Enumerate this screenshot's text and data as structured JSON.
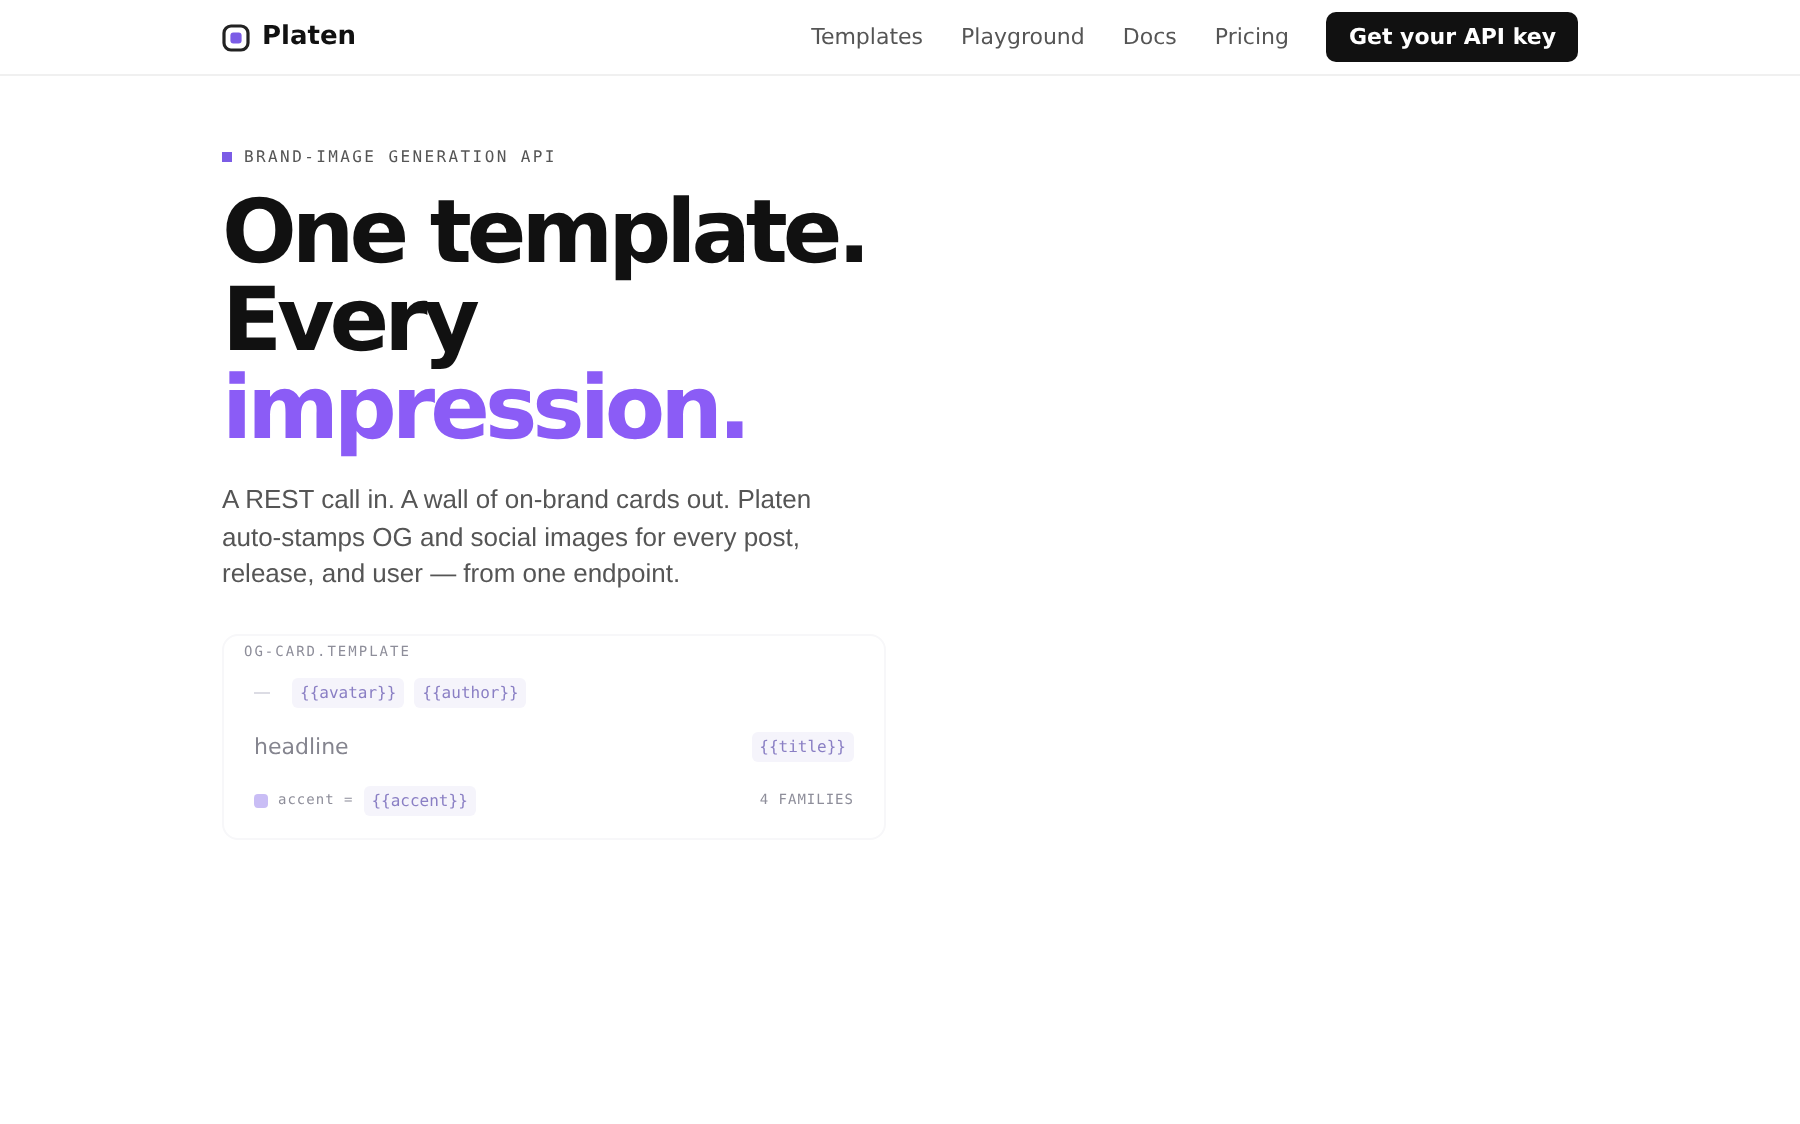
{
  "brand": {
    "name": "Platen"
  },
  "nav": [
    {
      "label": "Templates"
    },
    {
      "label": "Playground"
    },
    {
      "label": "Docs"
    },
    {
      "label": "Pricing"
    }
  ],
  "cta": {
    "label": "Get your API key"
  },
  "hero": {
    "eyebrow": "BRAND-IMAGE GENERATION API",
    "headline": [
      {
        "text": "One template.",
        "accent": false
      },
      {
        "text": "Every",
        "accent": false
      },
      {
        "text": "impression.",
        "accent": true
      }
    ],
    "lede": "A REST call in. A wall of on-brand cards out. Platen auto-stamps OG and social images for every post, release, and user — from one endpoint."
  },
  "card": {
    "label": "OG-CARD.TEMPLATE",
    "rows": [
      {
        "kind": "tokens",
        "tokens": [
          "{{avatar}}",
          "{{author}}"
        ]
      },
      {
        "kind": "headline",
        "text": "headline",
        "token": "{{title}}"
      },
      {
        "kind": "accent",
        "text": "accent =",
        "token": "{{accent}}",
        "note": "4 FAMILIES"
      }
    ]
  }
}
